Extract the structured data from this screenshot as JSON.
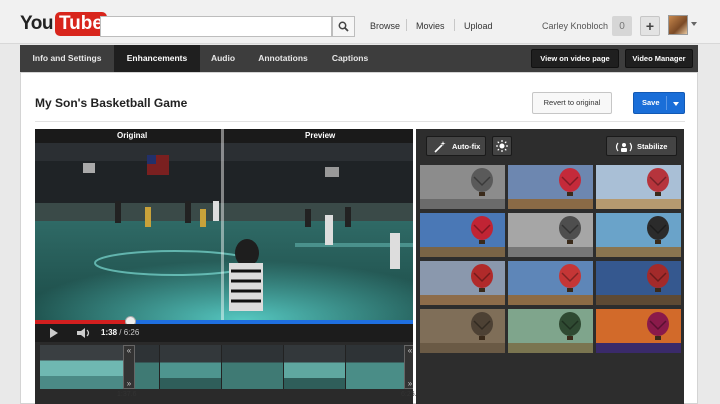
{
  "masthead": {
    "logo_you": "You",
    "logo_tube": "Tube",
    "search_placeholder": "",
    "nav": [
      "Browse",
      "Movies",
      "Upload"
    ],
    "user_name": "Carley Knobloch",
    "notifications": "0"
  },
  "tabs": {
    "items": [
      "Info and Settings",
      "Enhancements",
      "Audio",
      "Annotations",
      "Captions"
    ],
    "active": "Enhancements",
    "view_on_video_page": "View on video page",
    "video_manager": "Video Manager"
  },
  "editor": {
    "title": "My Son's Basketball Game",
    "revert_label": "Revert to original",
    "save_label": "Save"
  },
  "player": {
    "original_label": "Original",
    "preview_label": "Preview",
    "current_time": "1:38",
    "duration": "/ 6:26",
    "progress_fraction": 0.25,
    "trim_start": "1:37.6",
    "trim_end": "6:25.8"
  },
  "filters": {
    "autofix_label": "Auto-fix",
    "stabilize_label": "Stabilize",
    "thumbnails": [
      {
        "name": "grayscale-sky",
        "sky": "#8c8c8c",
        "balloon": "#5a5a5a",
        "ground": "#6b6b6b"
      },
      {
        "name": "warm-sky",
        "sky": "#6d87b0",
        "balloon": "#c42a3a",
        "ground": "#8a6a46"
      },
      {
        "name": "faded-blue",
        "sky": "#a9bfd6",
        "balloon": "#b6343c",
        "ground": "#b69a70"
      },
      {
        "name": "cool-blue",
        "sky": "#4a78b6",
        "balloon": "#c02434",
        "ground": "#7a6446"
      },
      {
        "name": "bw-contrast",
        "sky": "#a6a6a6",
        "balloon": "#4e4e4e",
        "ground": "#777777"
      },
      {
        "name": "cyan-tint",
        "sky": "#6aa3c9",
        "balloon": "#2b2b2b",
        "ground": "#8a7550"
      },
      {
        "name": "vintage",
        "sky": "#8a98ad",
        "balloon": "#b02a2a",
        "ground": "#8d6c4a"
      },
      {
        "name": "natural",
        "sky": "#5e86b8",
        "balloon": "#c53636",
        "ground": "#8c6b45"
      },
      {
        "name": "deep-blue",
        "sky": "#35588f",
        "balloon": "#a32a2a",
        "ground": "#5e4a34"
      },
      {
        "name": "sepia",
        "sky": "#7f6e58",
        "balloon": "#4d4134",
        "ground": "#6a5a45"
      },
      {
        "name": "green-tint",
        "sky": "#7fa58c",
        "balloon": "#2f4a32",
        "ground": "#7a7550"
      },
      {
        "name": "sunset",
        "sky": "#d26a2a",
        "balloon": "#8a1a4a",
        "ground": "#3a2a6a"
      }
    ]
  }
}
